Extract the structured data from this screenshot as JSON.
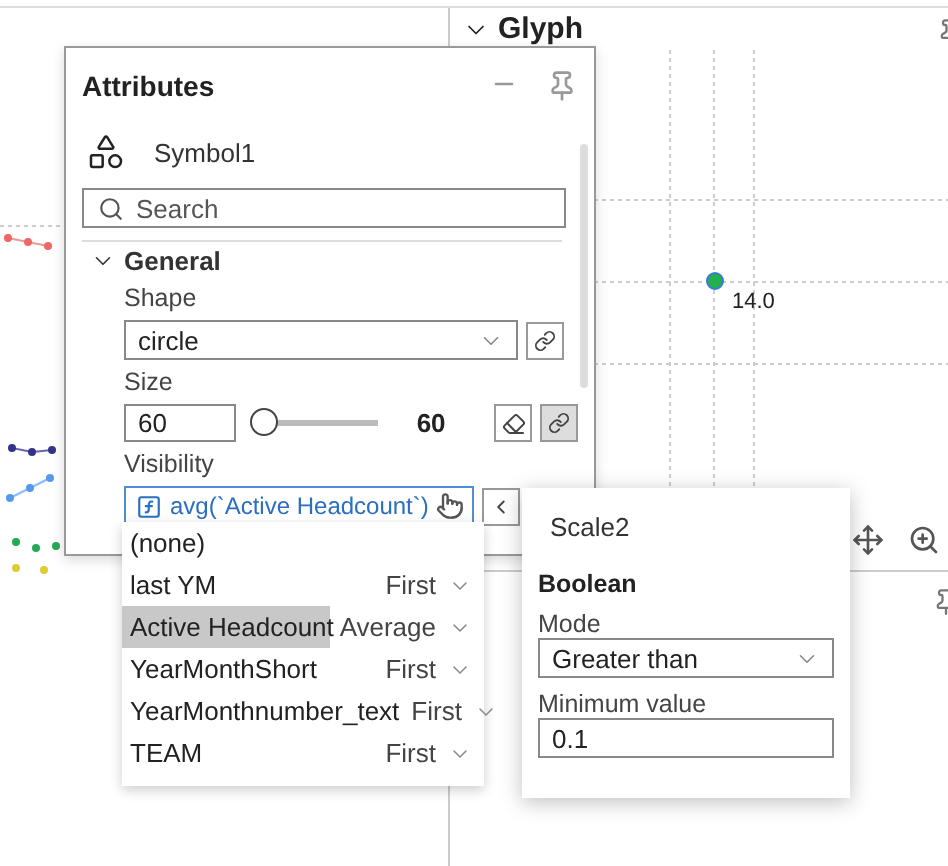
{
  "glyph_pane": {
    "title": "Glyph",
    "point_label": "14.0"
  },
  "attributes": {
    "title": "Attributes",
    "symbol": "Symbol1",
    "search": {
      "placeholder": "Search"
    },
    "section": {
      "title": "General",
      "expanded": true
    },
    "shape": {
      "label": "Shape",
      "value": "circle",
      "linked": false
    },
    "size": {
      "label": "Size",
      "value": "60",
      "level": 0.05,
      "reading": "60",
      "linked": true
    },
    "visibility": {
      "label": "Visibility",
      "value": "avg(`Active Headcount`)"
    }
  },
  "column_menu": {
    "items": [
      {
        "name": "(none)",
        "selected": false
      },
      {
        "name": "last YM",
        "aggregation": "First",
        "selected": false
      },
      {
        "name": "Active Headcount",
        "aggregation": "Average",
        "selected": true
      },
      {
        "name": "YearMonthShort",
        "aggregation": "First",
        "selected": false
      },
      {
        "name": "YearMonthnumber_text",
        "aggregation": "First",
        "selected": false
      },
      {
        "name": "TEAM",
        "aggregation": "First",
        "selected": false
      }
    ]
  },
  "scale_popup": {
    "title": "Scale2",
    "type": "Boolean",
    "mode_label": "Mode",
    "mode": "Greater than",
    "min_label": "Minimum value",
    "min_value": "0.1"
  }
}
